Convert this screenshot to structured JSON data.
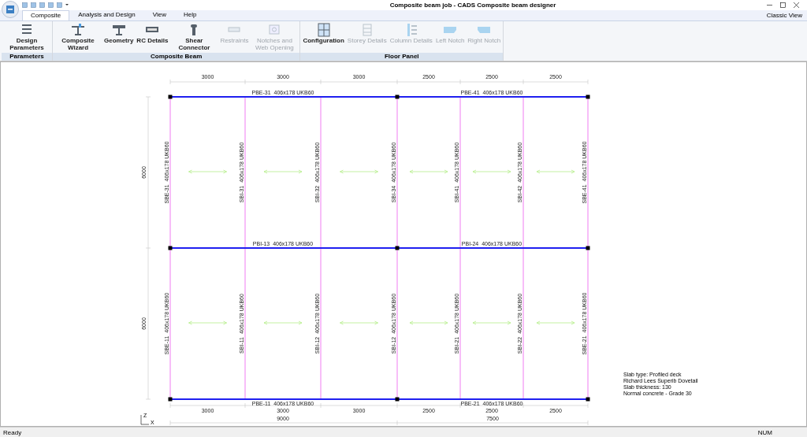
{
  "window": {
    "title": "Composite beam job - CADS Composite beam designer"
  },
  "tabs": [
    {
      "label": "Composite",
      "selected": true
    },
    {
      "label": "Analysis and Design",
      "selected": false
    },
    {
      "label": "View",
      "selected": false
    },
    {
      "label": "Help",
      "selected": false
    }
  ],
  "classic_view": "Classic View",
  "ribbon_groups": [
    {
      "title": "Parameters",
      "buttons": [
        {
          "label": "Design Parameters",
          "disabled": false
        }
      ]
    },
    {
      "title": "Composite Beam",
      "buttons": [
        {
          "label": "Composite Wizard",
          "disabled": false
        },
        {
          "label": "Geometry",
          "disabled": false
        },
        {
          "label": "RC Details",
          "disabled": false
        },
        {
          "label": "Shear Connector",
          "disabled": false
        },
        {
          "label": "Restraints",
          "disabled": true
        },
        {
          "label": "Notches and Web Opening",
          "disabled": true
        }
      ]
    },
    {
      "title": "Floor Panel",
      "buttons": [
        {
          "label": "Configuration",
          "disabled": false
        },
        {
          "label": "Storey Details",
          "disabled": true
        },
        {
          "label": "Column Details",
          "disabled": true
        },
        {
          "label": "Left Notch",
          "disabled": true
        },
        {
          "label": "Right Notch",
          "disabled": true
        }
      ]
    }
  ],
  "plan": {
    "top_dimensions": [
      "3000",
      "3000",
      "3000",
      "2500",
      "2500",
      "2500"
    ],
    "bottom_dimensions": [
      "3000",
      "3000",
      "3000",
      "2500",
      "2500",
      "2500"
    ],
    "bottom_totals": [
      "9000",
      "7500"
    ],
    "left_dimensions": [
      "6000",
      "6000"
    ],
    "horizontal_beams": [
      {
        "label": "PBE-31  406x178 UKB60"
      },
      {
        "label": "PBE-41  406x178 UKB60"
      },
      {
        "label": "PBI-13  406x178 UKB60"
      },
      {
        "label": "PBI-24  406x178 UKB60"
      },
      {
        "label": "PBE-11  406x178 UKB60"
      },
      {
        "label": "PBE-21  406x178 UKB60"
      }
    ],
    "vertical_beams_upper": [
      "SBE-31  406x178 UKB60",
      "SBI-31  406x178 UKB60",
      "SBI-32  406x178 UKB60",
      "SBI-34  406x178 UKB60",
      "SBI-41  406x178 UKB60",
      "SBI-42  406x178 UKB60",
      "SBE-41  406x178 UKB60"
    ],
    "vertical_beams_lower": [
      "SBE-11  406x178 UKB60",
      "SBI-11  406x178 UKB60",
      "SBI-12  406x178 UKB60",
      "SBI-12  406x178 UKB60",
      "SBI-21  406x178 UKB60",
      "SBI-22  406x178 UKB60",
      "SBE-21  406x178 UKB60"
    ],
    "axis": {
      "z": "Z",
      "x": "X"
    }
  },
  "notes": [
    "Slab type: Profiled deck",
    "Richard Lees Superib Dovetail",
    "Slab thickness: 130",
    "Normal concrete - Grade 30"
  ],
  "status_bar": {
    "left": "Ready",
    "right": "NUM"
  }
}
